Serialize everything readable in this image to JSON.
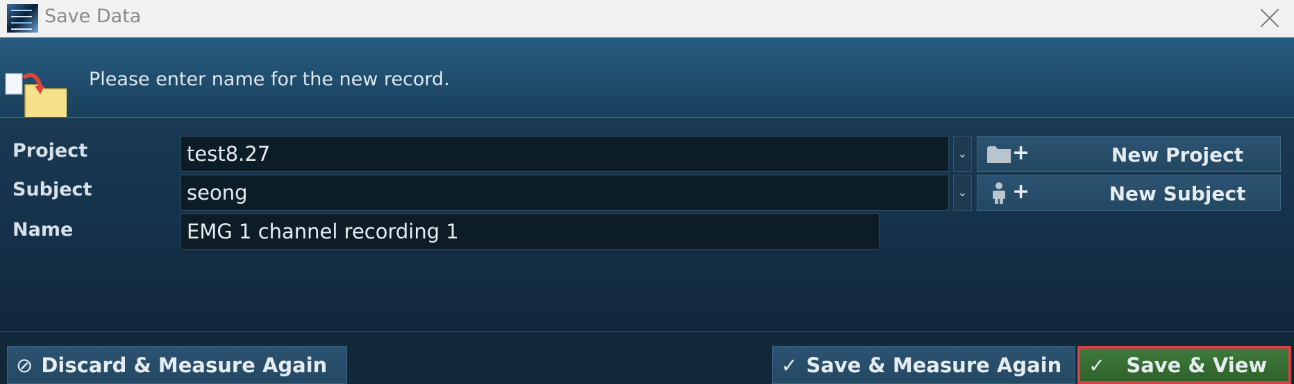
{
  "window": {
    "title": "Save Data",
    "close_icon": "close-icon"
  },
  "header": {
    "instruction": "Please enter name for the new record."
  },
  "form": {
    "project_label": "Project",
    "project_value": "test8.27",
    "subject_label": "Subject",
    "subject_value": "seong",
    "name_label": "Name",
    "name_value": "EMG 1 channel recording 1",
    "dropdown_glyph": "⌄",
    "new_project_label": "New Project",
    "new_subject_label": "New Subject",
    "plus_glyph": "+"
  },
  "footer": {
    "discard_icon": "⊘",
    "discard_label": "Discard & Measure Again",
    "save_measure_icon": "✓",
    "save_measure_label": "Save & Measure Again",
    "save_view_icon": "✓",
    "save_view_label": "Save & View"
  },
  "colors": {
    "accent_green": "#3f7a3b",
    "highlight_red": "#d64048",
    "panel_blue": "#275b80"
  }
}
